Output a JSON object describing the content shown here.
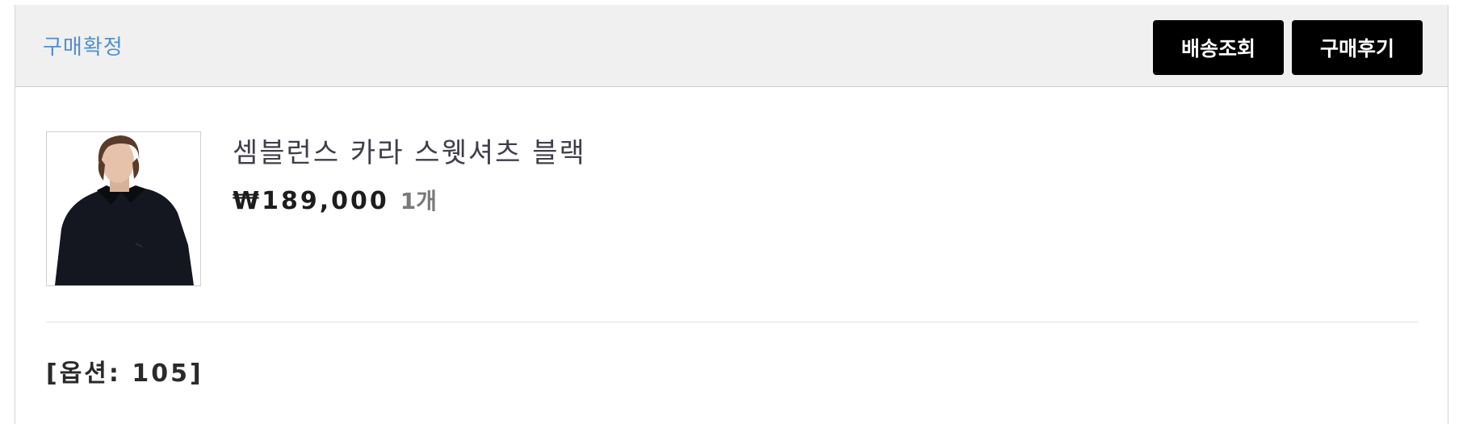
{
  "order": {
    "status": "구매확정",
    "buttons": {
      "tracking": "배송조회",
      "review": "구매후기"
    },
    "product": {
      "name": "셈블런스 카라 스웻셔츠 블랙",
      "price": "₩189,000",
      "quantity": "1개",
      "option": "[옵션: 105]"
    }
  },
  "colors": {
    "status": "#4f8fd0",
    "button_bg": "#000000",
    "header_bg": "#f0f0f0"
  }
}
